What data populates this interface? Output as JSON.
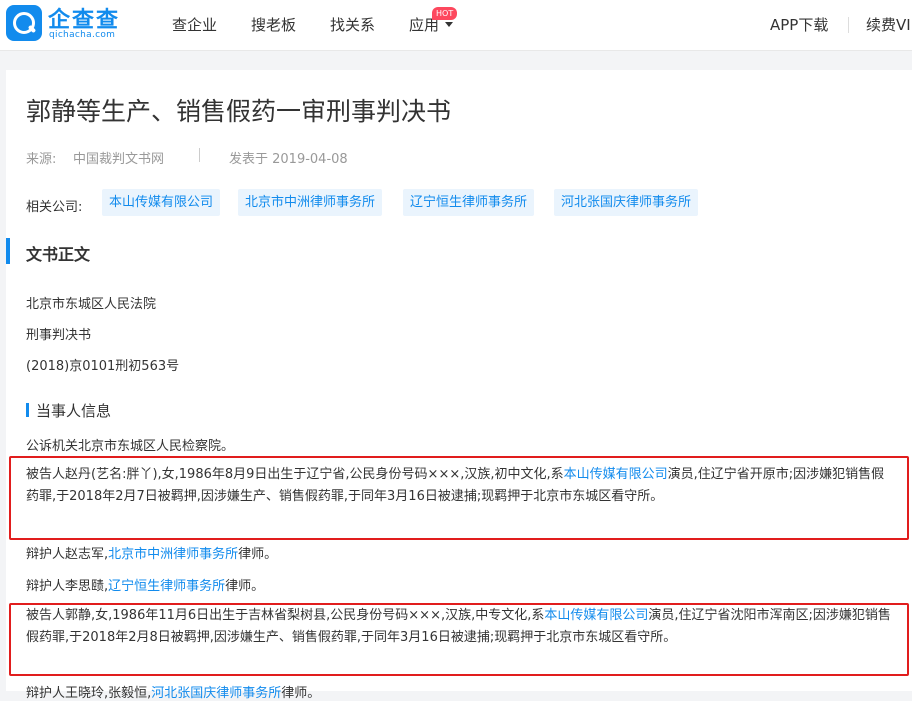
{
  "header": {
    "logo_name": "企查查",
    "logo_domain": "qichacha.com",
    "nav": [
      "查企业",
      "搜老板",
      "找关系",
      "应用"
    ],
    "hot_badge": "HOT",
    "app_download": "APP下载",
    "renew": "续费VI"
  },
  "document": {
    "title": "郭静等生产、销售假药一审刑事判决书",
    "source_label": "来源:",
    "source_value": "中国裁判文书网",
    "published": "发表于 2019-04-08",
    "related_label": "相关公司:",
    "related_companies": [
      "本山传媒有限公司",
      "北京市中洲律师事务所",
      "辽宁恒生律师事务所",
      "河北张国庆律师事务所"
    ],
    "section_title": "文书正文",
    "court": "北京市东城区人民法院",
    "doc_type": "刑事判决书",
    "case_no": "(2018)京0101刑初563号",
    "parties_title": "当事人信息",
    "prosecutor": "公诉机关北京市东城区人民检察院。",
    "defendant1": {
      "pre": "被告人赵丹(艺名:胖丫),女,1986年8月9日出生于辽宁省,公民身份号码×××,汉族,初中文化,系",
      "company": "本山传媒有限公司",
      "post": "演员,住辽宁省开原市;因涉嫌犯销售假药罪,于2018年2月7日被羁押,因涉嫌生产、销售假药罪,于同年3月16日被逮捕;现羁押于北京市东城区看守所。"
    },
    "defender1": {
      "pre": "辩护人赵志军,",
      "firm": "北京市中洲律师事务所",
      "post": "律师。"
    },
    "defender2": {
      "pre": "辩护人李思赜,",
      "firm": "辽宁恒生律师事务所",
      "post": "律师。"
    },
    "defendant2": {
      "pre": "被告人郭静,女,1986年11月6日出生于吉林省梨树县,公民身份号码×××,汉族,中专文化,系",
      "company": "本山传媒有限公司",
      "post": "演员,住辽宁省沈阳市浑南区;因涉嫌犯销售假药罪,于2018年2月8日被羁押,因涉嫌生产、销售假药罪,于同年3月16日被逮捕;现羁押于北京市东城区看守所。"
    },
    "defender3": {
      "pre": "辩护人王晓玲,张毅恒,",
      "firm": "河北张国庆律师事务所",
      "post": "律师。"
    }
  },
  "colors": {
    "brand": "#128bed",
    "highlight_box": "#e11d1d",
    "hot": "#fd485e"
  }
}
